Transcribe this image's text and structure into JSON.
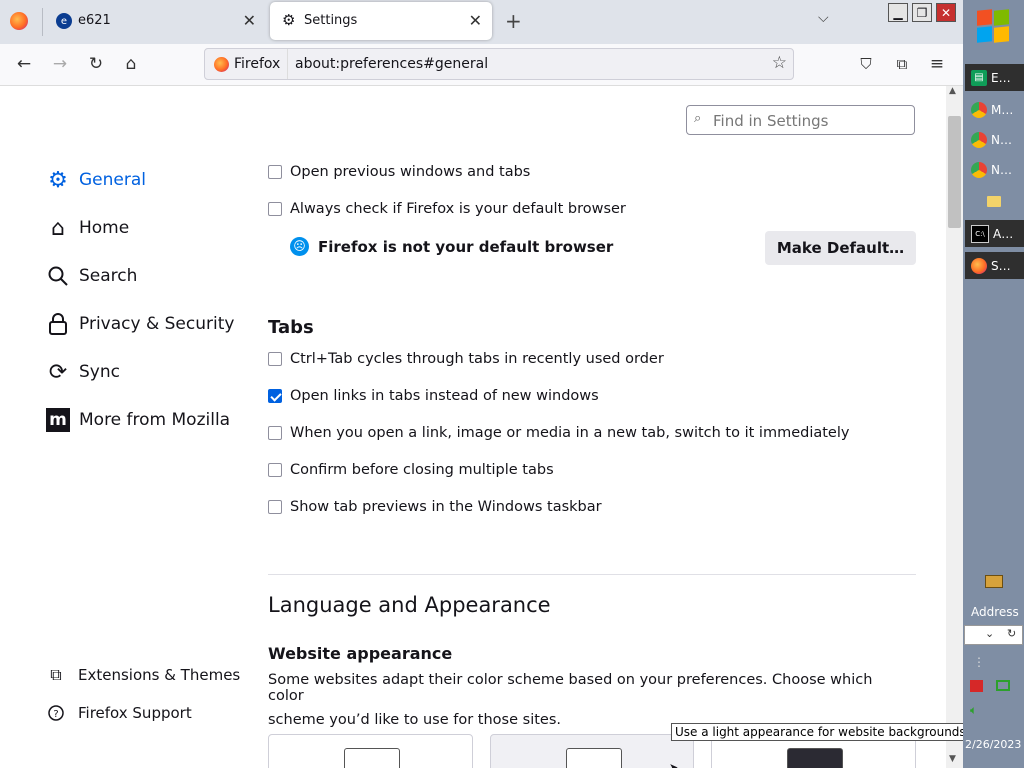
{
  "tabs": [
    {
      "label": "e621"
    },
    {
      "label": "Settings"
    }
  ],
  "urlbar": {
    "identity_label": "Firefox",
    "url": "about:preferences#general"
  },
  "search": {
    "placeholder": "Find in Settings"
  },
  "sidebar": {
    "categories": [
      {
        "label": "General",
        "icon": "gear-icon",
        "selected": true
      },
      {
        "label": "Home",
        "icon": "home-icon"
      },
      {
        "label": "Search",
        "icon": "search-icon"
      },
      {
        "label": "Privacy & Security",
        "icon": "lock-icon"
      },
      {
        "label": "Sync",
        "icon": "sync-icon"
      },
      {
        "label": "More from Mozilla",
        "icon": "mozilla-icon"
      }
    ],
    "footer": [
      {
        "label": "Extensions & Themes",
        "icon": "puzzle-icon"
      },
      {
        "label": "Firefox Support",
        "icon": "help-icon"
      }
    ]
  },
  "startup": {
    "open_previous": {
      "label": "Open previous windows and tabs",
      "checked": false
    },
    "always_check": {
      "label": "Always check if Firefox is your default browser",
      "checked": false
    },
    "not_default_text": "Firefox is not your default browser",
    "make_default_label": "Make Default…"
  },
  "tabs_section": {
    "title": "Tabs",
    "options": [
      {
        "label": "Ctrl+Tab cycles through tabs in recently used order",
        "checked": false
      },
      {
        "label": "Open links in tabs instead of new windows",
        "checked": true
      },
      {
        "label": "When you open a link, image or media in a new tab, switch to it immediately",
        "checked": false
      },
      {
        "label": "Confirm before closing multiple tabs",
        "checked": false
      },
      {
        "label": "Show tab previews in the Windows taskbar",
        "checked": false
      }
    ]
  },
  "language_section": {
    "title": "Language and Appearance",
    "website_appearance_title": "Website appearance",
    "website_appearance_desc_line1": "Some websites adapt their color scheme based on your preferences. Choose which color",
    "website_appearance_desc_line2": "scheme you’d like to use for those sites."
  },
  "tooltip": "Use a light appearance for website backgrounds and content.",
  "taskbar": {
    "items": [
      {
        "label": "E…"
      },
      {
        "label": "M…"
      },
      {
        "label": "N…"
      },
      {
        "label": "N…"
      },
      {
        "label": ""
      },
      {
        "label": "A…"
      },
      {
        "label": "S…"
      }
    ],
    "address_label": "Address",
    "clock_partial": "2/26/2023"
  },
  "colors": {
    "accent": "#0061e0",
    "tabbar_bg": "#dfe3ea",
    "taskbar_bg": "#7f8ea4"
  }
}
